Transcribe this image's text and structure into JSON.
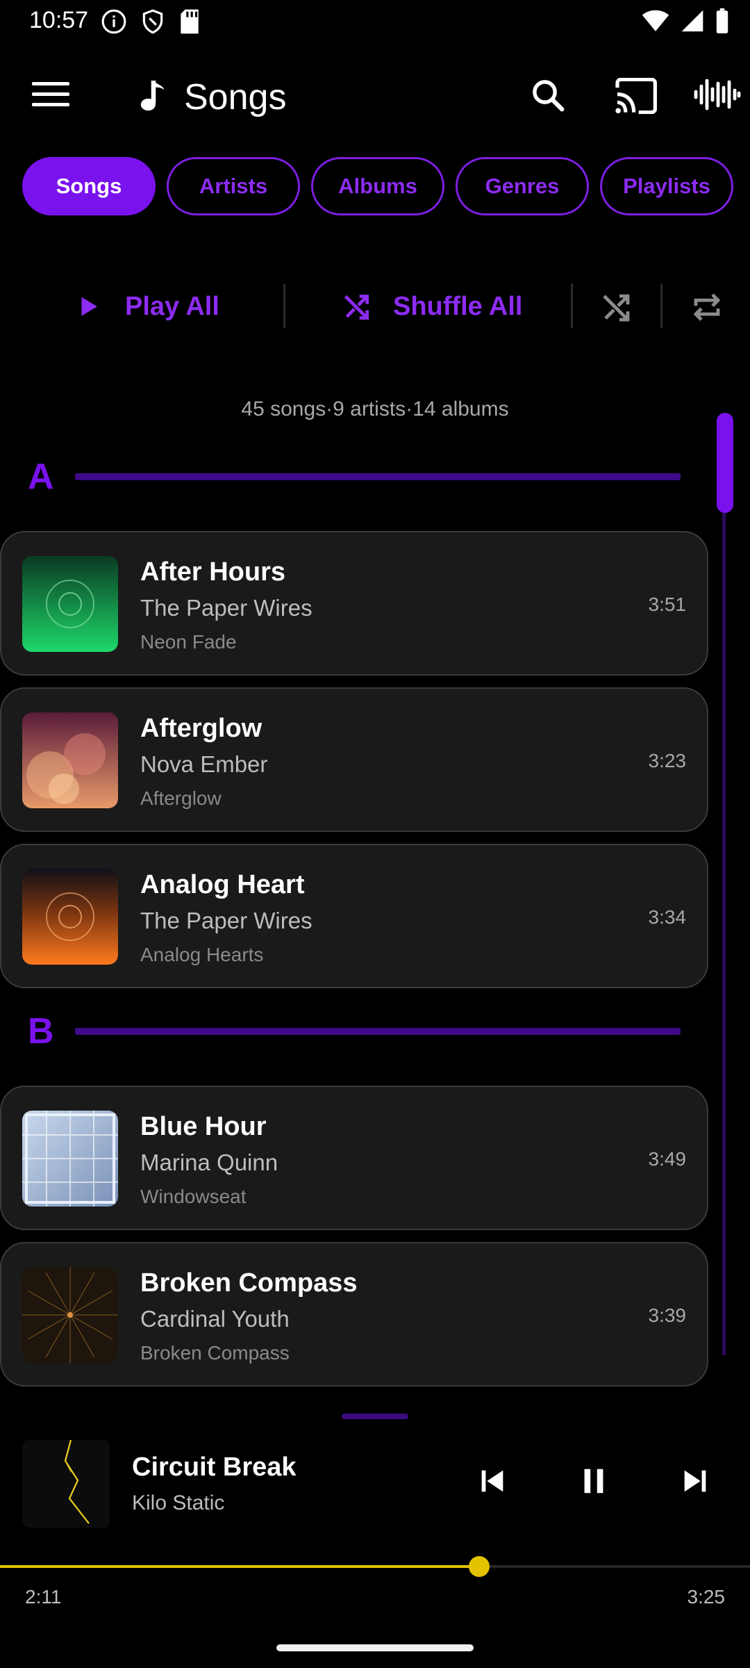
{
  "status_bar": {
    "time": "10:57",
    "left_icons": [
      "info-icon",
      "shield-icon",
      "sd-card-icon"
    ],
    "right_icons": [
      "wifi-icon",
      "signal-icon",
      "battery-icon"
    ]
  },
  "top_bar": {
    "title": "Songs",
    "icons": [
      "menu-icon",
      "music-note-icon",
      "search-icon",
      "cast-icon",
      "waveform-icon"
    ]
  },
  "tabs": [
    {
      "label": "Songs",
      "active": true
    },
    {
      "label": "Artists",
      "active": false
    },
    {
      "label": "Albums",
      "active": false
    },
    {
      "label": "Genres",
      "active": false
    },
    {
      "label": "Playlists",
      "active": false
    }
  ],
  "actions": {
    "play_all": "Play All",
    "shuffle_all": "Shuffle All"
  },
  "summary": "45 songs·9 artists·14 albums",
  "sections": [
    {
      "letter": "A",
      "songs": [
        {
          "title": "After Hours",
          "artist": "The Paper Wires",
          "album": "Neon Fade",
          "duration": "3:51"
        },
        {
          "title": "Afterglow",
          "artist": "Nova Ember",
          "album": "Afterglow",
          "duration": "3:23"
        },
        {
          "title": "Analog Heart",
          "artist": "The Paper Wires",
          "album": "Analog Hearts",
          "duration": "3:34"
        }
      ]
    },
    {
      "letter": "B",
      "songs": [
        {
          "title": "Blue Hour",
          "artist": "Marina Quinn",
          "album": "Windowseat",
          "duration": "3:49"
        },
        {
          "title": "Broken Compass",
          "artist": "Cardinal Youth",
          "album": "Broken Compass",
          "duration": "3:39"
        }
      ]
    }
  ],
  "now_playing": {
    "title": "Circuit Break",
    "artist": "Kilo Static",
    "elapsed": "2:11",
    "total": "3:25",
    "progress": 0.639
  },
  "colors": {
    "accent": "#7a12ee",
    "accent_text": "#8d2cf2",
    "progress": "#e3c200",
    "card_bg": "#1a1a1a"
  }
}
